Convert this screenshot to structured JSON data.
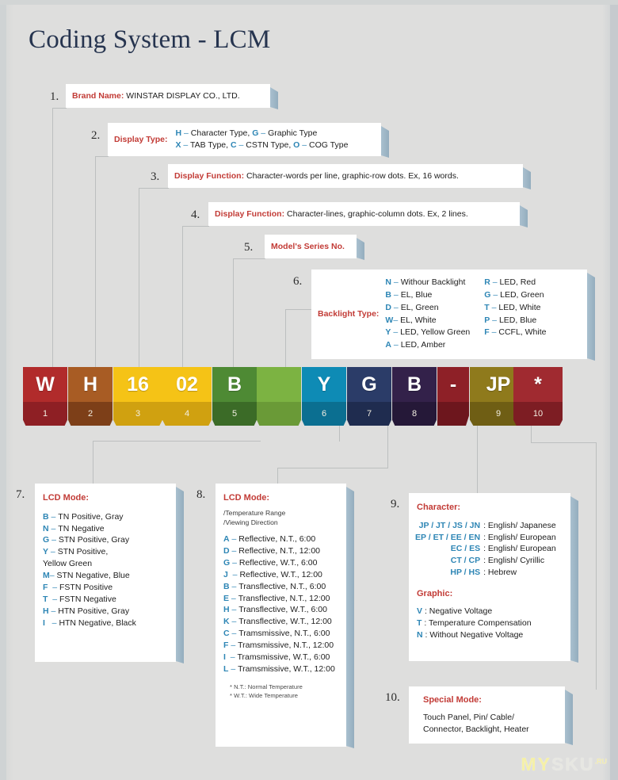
{
  "page": {
    "title": "Coding System - LCM",
    "background_color": "#dededd",
    "title_color": "#26344f",
    "heading_color": "#c23b36",
    "key_color": "#2e86b5",
    "watermark": {
      "part1": "M",
      "part2": "Y",
      "part3": "SKU",
      "sup": ".RU"
    }
  },
  "callouts": [
    {
      "num": "1.",
      "label": "Brand Name:",
      "text": "WINSTAR DISPLAY CO., LTD."
    },
    {
      "num": "2.",
      "label": "Display Type:",
      "line1": "H – Character Type,   G – Graphic Type",
      "line2": "X – TAB Type, C – CSTN Type, O – COG Type"
    },
    {
      "num": "3.",
      "label": "Display Function:",
      "text": "Character-words per line, graphic-row dots. Ex, 16 words."
    },
    {
      "num": "4.",
      "label": "Display Function:",
      "text": "Character-lines, graphic-column dots. Ex, 2 lines."
    },
    {
      "num": "5.",
      "label": "Model's Series No.",
      "text": ""
    },
    {
      "num": "6.",
      "label": "Backlight Type:",
      "entries": [
        "N – Withour Backlight",
        "R – LED, Red",
        "B – EL, Blue",
        "G – LED, Green",
        "D – EL, Green",
        "T – LED, White",
        "W– EL, White",
        "P – LED, Blue",
        "Y – LED, Yellow Green",
        "F – CCFL, White",
        "A – LED, Amber",
        ""
      ]
    },
    {
      "num": "7.",
      "label": "LCD Mode:",
      "entries": [
        "B – TN Positive, Gray",
        "N – TN Negative",
        "G – STN Positive, Gray",
        "Y – STN Positive,",
        "     Yellow Green",
        "M– STN Negative, Blue",
        "F  – FSTN Positive",
        "T  – FSTN Negative",
        "H – HTN Positive, Gray",
        "I   – HTN Negative, Black"
      ]
    },
    {
      "num": "8.",
      "label": "LCD Mode:",
      "sub1": "/Temperature Range",
      "sub2": "/Viewing Direction",
      "entries": [
        "A – Reflective, N.T., 6:00",
        "D – Reflective, N.T., 12:00",
        "G – Reflective, W.T., 6:00",
        "J  – Reflective, W.T., 12:00",
        "B – Transflective, N.T., 6:00",
        "E – Transflective, N.T., 12:00",
        "H – Transflective, W.T., 6:00",
        "K – Transflective, W.T., 12:00",
        "C – Tramsmissive, N.T., 6:00",
        "F – Tramsmissive, N.T., 12:00",
        "I  – Tramsmissive, W.T., 6:00",
        "L – Tramsmissive, W.T., 12:00"
      ],
      "foot1": "* N.T.: Normal Temperature",
      "foot2": "* W.T.: Wide Temperature"
    },
    {
      "num": "9.",
      "label": "Character:",
      "char_rows": [
        {
          "k": "JP / JT / JS / JN",
          "v": ": English/ Japanese"
        },
        {
          "k": "EP / ET / EE / EN",
          "v": ": English/ European"
        },
        {
          "k": "EC / ES",
          "v": ": English/ European"
        },
        {
          "k": "CT / CP",
          "v": ": English/ Cyrillic"
        },
        {
          "k": "HP / HS",
          "v": ": Hebrew"
        }
      ],
      "label2": "Graphic:",
      "graphic_rows": [
        {
          "k": "V",
          "v": ": Negative Voltage"
        },
        {
          "k": "T",
          "v": ": Temperature Compensation"
        },
        {
          "k": "N",
          "v": ": Without Negative Voltage"
        }
      ]
    },
    {
      "num": "10.",
      "label": "Special Mode:",
      "line1": "Touch Panel, Pin/ Cable/",
      "line2": "Connector, Backlight, Heater"
    }
  ],
  "code_blocks": [
    {
      "char": "W",
      "index": "1",
      "face": "#b12b2b",
      "base": "#8e1f24"
    },
    {
      "char": "H",
      "index": "2",
      "face": "#a85c24",
      "base": "#7d3f18"
    },
    {
      "char": "16",
      "index": "3",
      "face": "#f5c316",
      "base": "#d0a110"
    },
    {
      "char": "02",
      "index": "4",
      "face": "#f5c316",
      "base": "#d0a110"
    },
    {
      "char": "B",
      "index": "5",
      "face": "#4e8a34",
      "base": "#3b6b27"
    },
    {
      "char": "",
      "index": "",
      "face": "#7cb342",
      "base": "#6a9a37"
    },
    {
      "char": "Y",
      "index": "6",
      "face": "#0e8bb5",
      "base": "#0b6f91"
    },
    {
      "char": "G",
      "index": "7",
      "face": "#2b3c68",
      "base": "#1f2c4f"
    },
    {
      "char": "B",
      "index": "8",
      "face": "#33214a",
      "base": "#251838"
    },
    {
      "char": "-",
      "index": "",
      "face": "#8e2027",
      "base": "#6d161d"
    },
    {
      "char": "JP",
      "index": "9",
      "face": "#8f7a1c",
      "base": "#6f5e14"
    },
    {
      "char": "*",
      "index": "10",
      "face": "#a02a30",
      "base": "#7d1d23"
    }
  ]
}
